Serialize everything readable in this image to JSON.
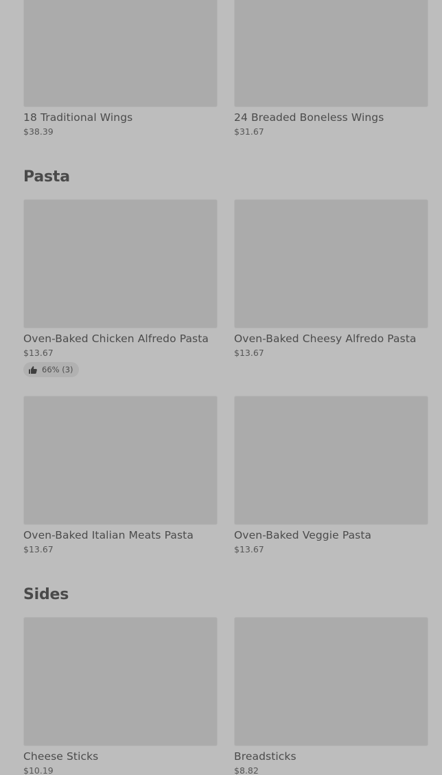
{
  "items_top": [
    {
      "name": "18 Traditional Wings",
      "price": "$38.39"
    },
    {
      "name": "24 Breaded Boneless Wings",
      "price": "$31.67"
    }
  ],
  "sections": [
    {
      "title": "Pasta",
      "items": [
        {
          "name": "Oven-Baked Chicken Alfredo Pasta",
          "price": "$13.67",
          "rating": "66% (3)",
          "rating_icon": "thumbs-up-icon"
        },
        {
          "name": "Oven-Baked Cheesy Alfredo Pasta",
          "price": "$13.67"
        },
        {
          "name": "Oven-Baked Italian Meats Pasta",
          "price": "$13.67"
        },
        {
          "name": "Oven-Baked Veggie Pasta",
          "price": "$13.67"
        }
      ]
    },
    {
      "title": "Sides",
      "items": [
        {
          "name": "Cheese Sticks",
          "price": "$10.19"
        },
        {
          "name": "Breadsticks",
          "price": "$8.82"
        }
      ]
    }
  ]
}
